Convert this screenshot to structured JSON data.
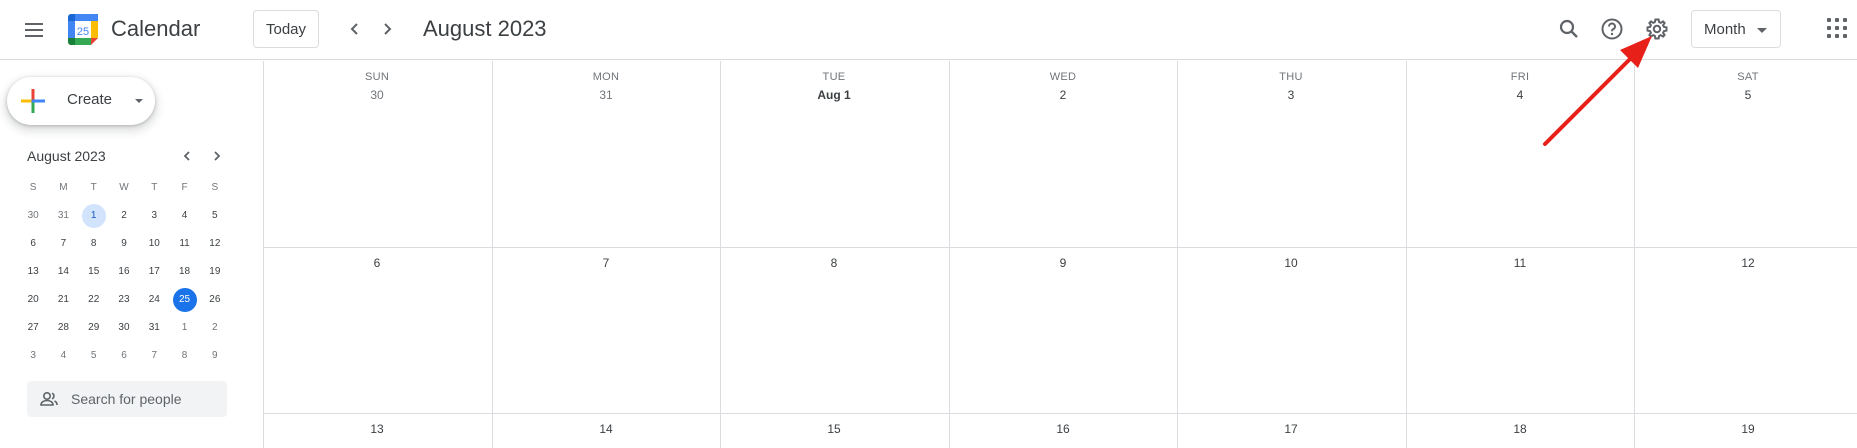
{
  "header": {
    "app_title": "Calendar",
    "logo_day": "25",
    "today_label": "Today",
    "current_period": "August 2023",
    "view_select": "Month"
  },
  "sidebar": {
    "create_label": "Create",
    "mini_calendar": {
      "title": "August 2023",
      "weekday_headers": [
        "S",
        "M",
        "T",
        "W",
        "T",
        "F",
        "S"
      ],
      "weeks": [
        [
          "30",
          "31",
          "1",
          "2",
          "3",
          "4",
          "5"
        ],
        [
          "6",
          "7",
          "8",
          "9",
          "10",
          "11",
          "12"
        ],
        [
          "13",
          "14",
          "15",
          "16",
          "17",
          "18",
          "19"
        ],
        [
          "20",
          "21",
          "22",
          "23",
          "24",
          "25",
          "26"
        ],
        [
          "27",
          "28",
          "29",
          "30",
          "31",
          "1",
          "2"
        ],
        [
          "3",
          "4",
          "5",
          "6",
          "7",
          "8",
          "9"
        ]
      ]
    },
    "search_people_placeholder": "Search for people"
  },
  "month_grid": {
    "weekdays": [
      "SUN",
      "MON",
      "TUE",
      "WED",
      "THU",
      "FRI",
      "SAT"
    ],
    "week1": [
      "30",
      "31",
      "Aug 1",
      "2",
      "3",
      "4",
      "5"
    ],
    "week2": [
      "6",
      "7",
      "8",
      "9",
      "10",
      "11",
      "12"
    ],
    "week3": [
      "13",
      "14",
      "15",
      "16",
      "17",
      "18",
      "19"
    ]
  },
  "colors": {
    "accent": "#1a73e8",
    "selected_bg": "#d2e3fc",
    "annotation_arrow": "#e8201a"
  },
  "icons": [
    "menu-icon",
    "calendar-logo-icon",
    "chevron-left-icon",
    "chevron-right-icon",
    "search-icon",
    "help-icon",
    "gear-icon",
    "apps-grid-icon",
    "people-icon",
    "plus-icon"
  ]
}
